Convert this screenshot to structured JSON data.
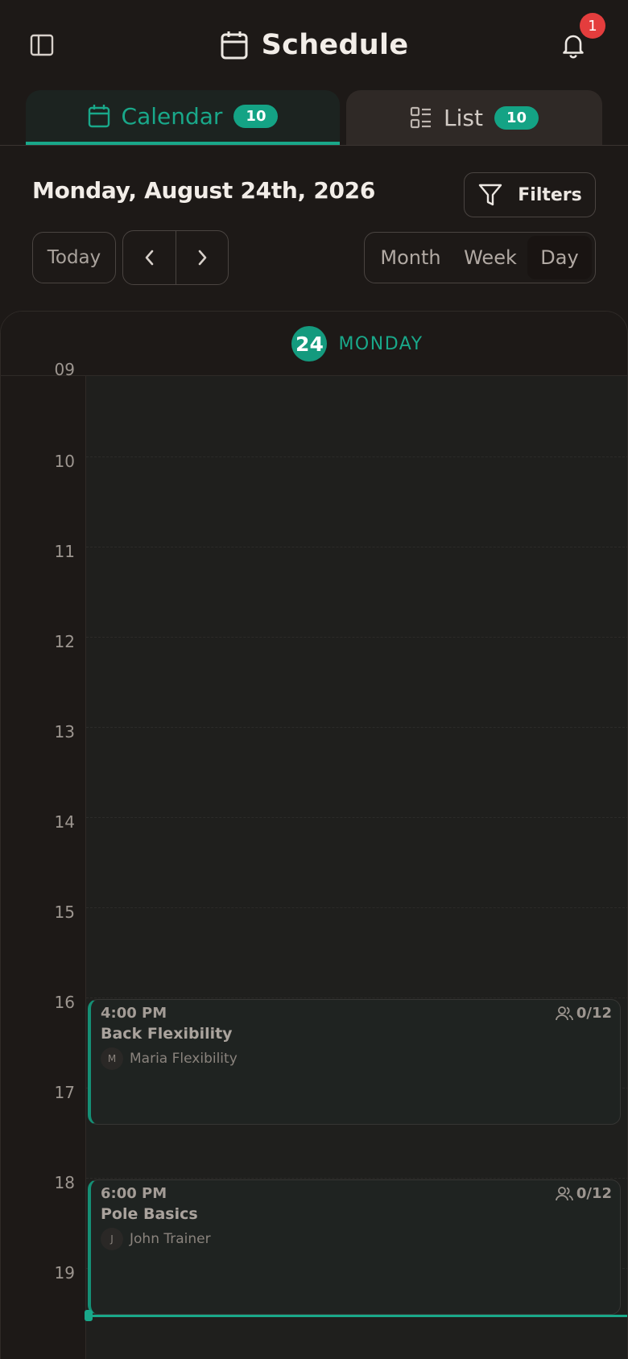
{
  "header": {
    "title": "Schedule",
    "notification_count": "1"
  },
  "tabs": [
    {
      "label": "Calendar",
      "count": "10",
      "active": true
    },
    {
      "label": "List",
      "count": "10",
      "active": false
    }
  ],
  "toolbar": {
    "current_date": "Monday, August 24th, 2026",
    "filters_label": "Filters",
    "today_label": "Today",
    "views": [
      "Month",
      "Week",
      "Day"
    ],
    "active_view": "Day"
  },
  "day_view": {
    "day_number": "24",
    "day_name": "MONDAY",
    "partial_top_label": "09",
    "hours": [
      "10",
      "11",
      "12",
      "13",
      "14",
      "15",
      "16",
      "17",
      "18",
      "19"
    ]
  },
  "events": [
    {
      "time": "4:00 PM",
      "title": "Back Flexibility",
      "trainer_initial": "M",
      "trainer": "Maria Flexibility",
      "capacity": "0/12"
    },
    {
      "time": "6:00 PM",
      "title": "Pole Basics",
      "trainer_initial": "J",
      "trainer": "John Trainer",
      "capacity": "0/12"
    }
  ],
  "colors": {
    "accent": "#19a88a",
    "background": "#1d1917",
    "badge_red": "#e43d3d"
  },
  "icons": [
    "sidebar-toggle-icon",
    "calendar-icon",
    "bell-icon",
    "list-icon",
    "filter-icon",
    "chevron-left-icon",
    "chevron-right-icon",
    "users-icon"
  ]
}
